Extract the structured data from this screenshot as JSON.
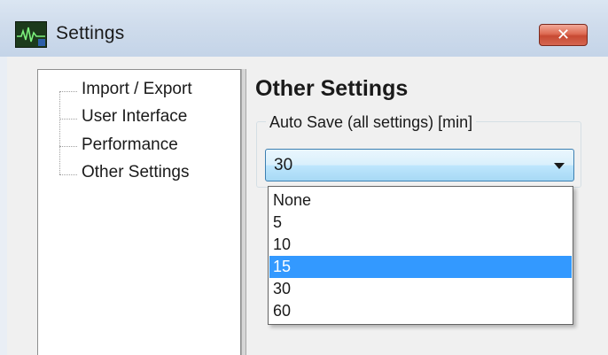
{
  "window": {
    "title": "Settings",
    "close_label": "✕"
  },
  "tree": {
    "items": [
      {
        "label": "Import / Export"
      },
      {
        "label": "User Interface"
      },
      {
        "label": "Performance"
      },
      {
        "label": "Other Settings"
      }
    ]
  },
  "panel": {
    "title": "Other Settings",
    "group_label": "Auto Save (all settings) [min]",
    "autosave_value": "30",
    "options": [
      "None",
      "5",
      "10",
      "15",
      "30",
      "60"
    ],
    "highlighted_option": "15"
  },
  "colors": {
    "highlight": "#3399ff",
    "combo_border": "#3c7fb1",
    "close_button": "#c74a33"
  },
  "icons": {
    "app": "waveform-app-icon",
    "close": "close-icon",
    "dropdown": "chevron-down-icon"
  }
}
